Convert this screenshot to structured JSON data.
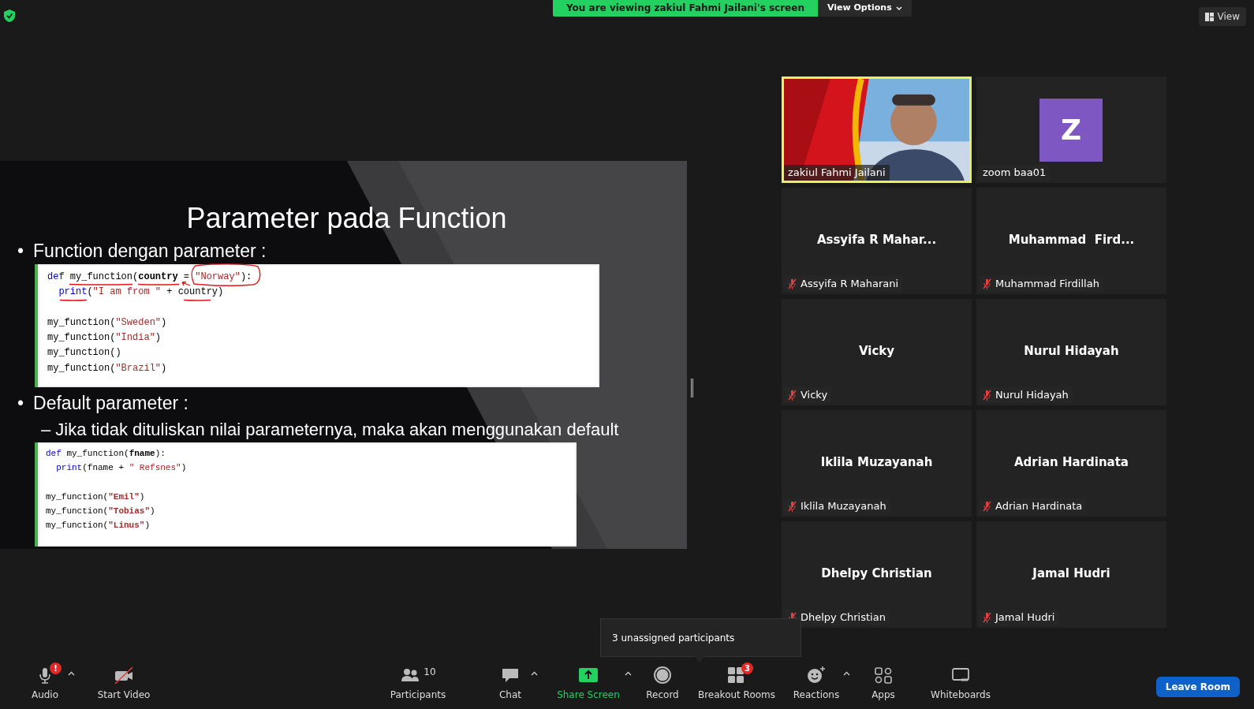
{
  "top_bar": {
    "viewing_banner": "You are viewing zakiul Fahmi Jailani's screen",
    "view_options": "View Options",
    "view_button": "View"
  },
  "slide": {
    "title": "Parameter pada Function",
    "sections": [
      {
        "marker": "•",
        "bullet": "Function dengan parameter :",
        "annotated": true,
        "code": [
          {
            "kind": "code",
            "indent": false,
            "tokens": [
              {
                "kind": "keyword",
                "text": "def "
              },
              {
                "kind": "plain",
                "text": "my_function("
              },
              {
                "kind": "bold",
                "text": "country"
              },
              {
                "kind": "plain",
                "text": " = "
              },
              {
                "kind": "string",
                "text": "\"Norway\""
              },
              {
                "kind": "plain",
                "text": "):"
              }
            ]
          },
          {
            "kind": "code",
            "indent": true,
            "tokens": [
              {
                "kind": "keyword",
                "text": "print"
              },
              {
                "kind": "plain",
                "text": "("
              },
              {
                "kind": "string",
                "text": "\"I am from \""
              },
              {
                "kind": "plain",
                "text": " + country)"
              }
            ]
          },
          {
            "kind": "blank"
          },
          {
            "kind": "code",
            "indent": false,
            "tokens": [
              {
                "kind": "plain",
                "text": "my_function("
              },
              {
                "kind": "string",
                "text": "\"Sweden\""
              },
              {
                "kind": "plain",
                "text": ")"
              }
            ]
          },
          {
            "kind": "code",
            "indent": false,
            "tokens": [
              {
                "kind": "plain",
                "text": "my_function("
              },
              {
                "kind": "string",
                "text": "\"India\""
              },
              {
                "kind": "plain",
                "text": ")"
              }
            ]
          },
          {
            "kind": "code",
            "indent": false,
            "tokens": [
              {
                "kind": "plain",
                "text": "my_function()"
              }
            ]
          },
          {
            "kind": "code",
            "indent": false,
            "tokens": [
              {
                "kind": "plain",
                "text": "my_function("
              },
              {
                "kind": "string",
                "text": "\"Brazil\""
              },
              {
                "kind": "plain",
                "text": ")"
              }
            ]
          }
        ]
      },
      {
        "marker": "•",
        "bullet": "Default parameter :",
        "annotated": false,
        "sub": [
          {
            "marker": "–",
            "text": "Jika tidak dituliskan nilai parameternya, maka akan menggunakan default"
          }
        ],
        "code": [
          {
            "kind": "code",
            "indent": false,
            "tokens": [
              {
                "kind": "keyword",
                "text": "def "
              },
              {
                "kind": "plain",
                "text": "my_function("
              },
              {
                "kind": "bold",
                "text": "fname"
              },
              {
                "kind": "plain",
                "text": "):"
              }
            ]
          },
          {
            "kind": "code",
            "indent": true,
            "tokens": [
              {
                "kind": "keyword",
                "text": "print"
              },
              {
                "kind": "plain",
                "text": "(fname + "
              },
              {
                "kind": "string",
                "text": "\" Refsnes\""
              },
              {
                "kind": "plain",
                "text": ")"
              }
            ]
          },
          {
            "kind": "blank"
          },
          {
            "kind": "code",
            "indent": false,
            "tokens": [
              {
                "kind": "plain",
                "text": "my_function("
              },
              {
                "kind": "string_bold",
                "text": "\"Emil\""
              },
              {
                "kind": "plain",
                "text": ")"
              }
            ]
          },
          {
            "kind": "code",
            "indent": false,
            "tokens": [
              {
                "kind": "plain",
                "text": "my_function("
              },
              {
                "kind": "string_bold",
                "text": "\"Tobias\""
              },
              {
                "kind": "plain",
                "text": ")"
              }
            ]
          },
          {
            "kind": "code",
            "indent": false,
            "tokens": [
              {
                "kind": "plain",
                "text": "my_function("
              },
              {
                "kind": "string_bold",
                "text": "\"Linus\""
              },
              {
                "kind": "plain",
                "text": ")"
              }
            ]
          }
        ]
      }
    ]
  },
  "tiles": [
    {
      "kind": "video",
      "label": "zakiul Fahmi Jailani",
      "muted": false,
      "active_speaker": true
    },
    {
      "kind": "avatar",
      "initial": "Z",
      "label": "zoom baa01",
      "muted": false,
      "active_speaker": false
    },
    {
      "kind": "name",
      "display_name": "Assyifa R Mahar...",
      "label": "Assyifa R Maharani",
      "muted": true,
      "active_speaker": false
    },
    {
      "kind": "name",
      "display_name": "Muhammad  Fird...",
      "label": "Muhammad Firdillah",
      "muted": true,
      "active_speaker": false
    },
    {
      "kind": "name",
      "display_name": "Vicky",
      "label": "Vicky",
      "muted": true,
      "active_speaker": false
    },
    {
      "kind": "name",
      "display_name": "Nurul Hidayah",
      "label": "Nurul Hidayah",
      "muted": true,
      "active_speaker": false
    },
    {
      "kind": "name",
      "display_name": "Iklila Muzayanah",
      "label": "Iklila Muzayanah",
      "muted": true,
      "active_speaker": false
    },
    {
      "kind": "name",
      "display_name": "Adrian Hardinata",
      "label": "Adrian Hardinata",
      "muted": true,
      "active_speaker": false
    },
    {
      "kind": "name",
      "display_name": "Dhelpy Christian",
      "label": "Dhelpy Christian",
      "muted": true,
      "active_speaker": false
    },
    {
      "kind": "name",
      "display_name": "Jamal Hudri",
      "label": "Jamal Hudri",
      "muted": true,
      "active_speaker": false
    }
  ],
  "tooltip": "3 unassigned participants",
  "toolbar": [
    {
      "kind": "audio",
      "label": "Audio",
      "badge": "!"
    },
    {
      "kind": "caret"
    },
    {
      "kind": "video",
      "label": "Start Video"
    },
    {
      "kind": "participants",
      "label": "Participants",
      "count": "10"
    },
    {
      "kind": "chat",
      "label": "Chat"
    },
    {
      "kind": "caret"
    },
    {
      "kind": "share",
      "label": "Share Screen"
    },
    {
      "kind": "caret"
    },
    {
      "kind": "record",
      "label": "Record"
    },
    {
      "kind": "breakout",
      "label": "Breakout Rooms",
      "badge": "3"
    },
    {
      "kind": "reactions",
      "label": "Reactions"
    },
    {
      "kind": "caret"
    },
    {
      "kind": "apps",
      "label": "Apps"
    },
    {
      "kind": "whiteboards",
      "label": "Whiteboards"
    }
  ],
  "leave_button": "Leave Room"
}
